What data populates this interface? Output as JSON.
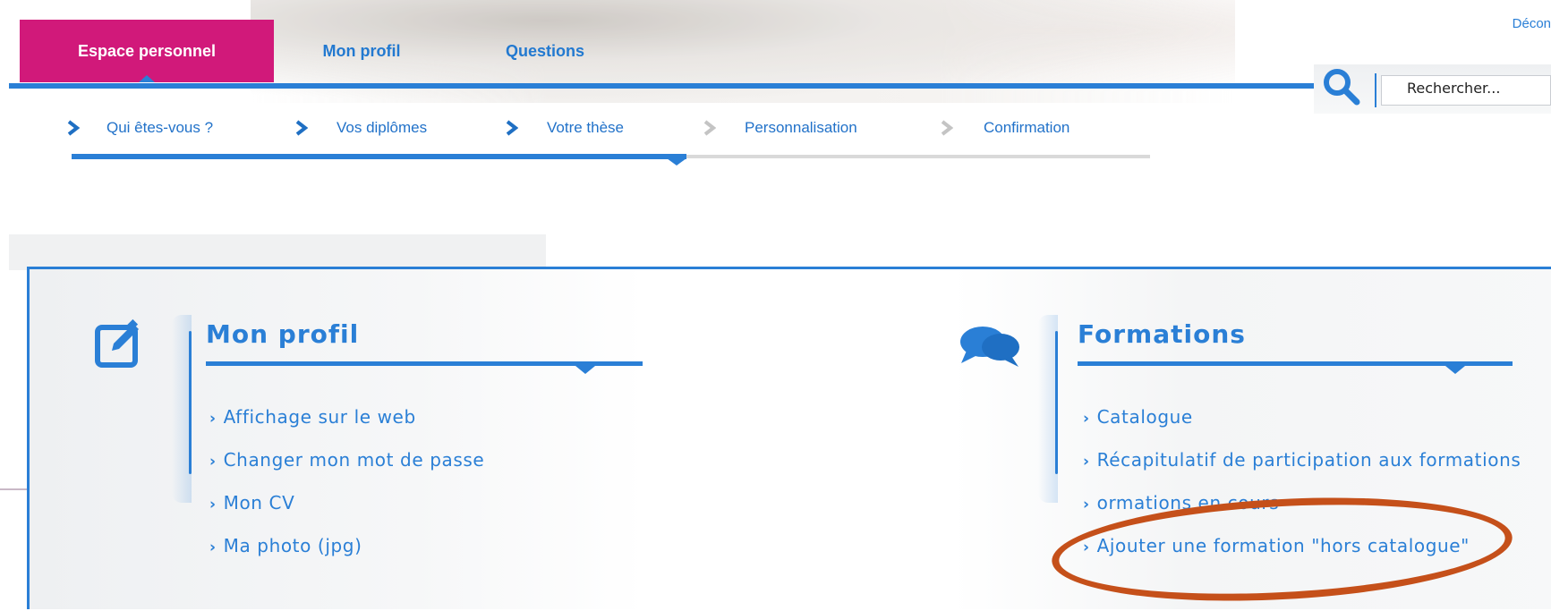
{
  "header": {
    "logout_label": "Décon",
    "tabs": [
      {
        "label": "Espace personnel",
        "active": true
      },
      {
        "label": "Mon profil",
        "active": false
      },
      {
        "label": "Questions",
        "active": false
      }
    ],
    "search": {
      "placeholder": "Rechercher..."
    }
  },
  "steps": [
    {
      "label": "Qui êtes-vous ?",
      "done": true
    },
    {
      "label": "Vos diplômes",
      "done": true
    },
    {
      "label": "Votre thèse",
      "done": true
    },
    {
      "label": "Personnalisation",
      "done": false
    },
    {
      "label": "Confirmation",
      "done": false
    }
  ],
  "progress_fraction": 0.57,
  "cards": {
    "profil": {
      "icon": "edit-icon",
      "title": "Mon profil",
      "links": [
        "Affichage sur le web",
        "Changer mon mot de passe",
        "Mon CV",
        "Ma photo (jpg)"
      ]
    },
    "formations": {
      "icon": "chat-bubbles-icon",
      "title": "Formations",
      "links": [
        "Catalogue",
        "Récapitulatif de participation aux formations",
        "ormations en cours",
        "Ajouter une formation \"hors catalogue\""
      ]
    }
  },
  "colors": {
    "accent": "#2a7fd6",
    "active_tab": "#d1197a",
    "annotation": "#c5501a"
  }
}
